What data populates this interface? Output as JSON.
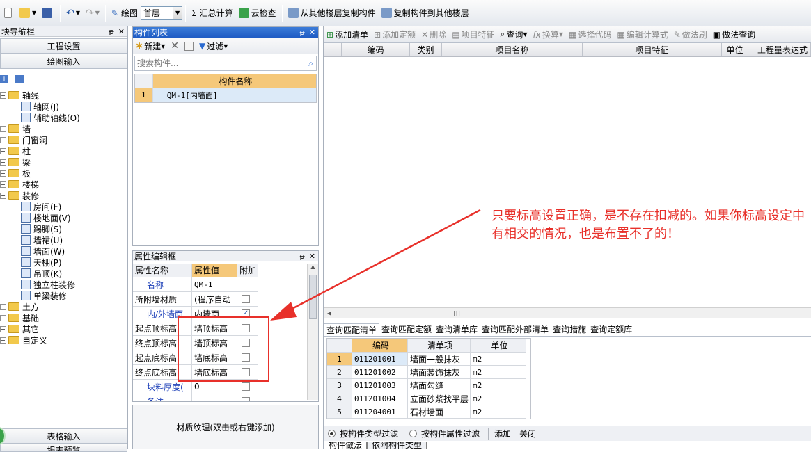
{
  "toolbar": {
    "draw_label": "绘图",
    "floor_value": "首层",
    "sum_label": "汇总计算",
    "cloud_check_label": "云检查",
    "copy_from_label": "从其他楼层复制构件",
    "copy_to_label": "复制构件到其他楼层"
  },
  "nav": {
    "title": "块导航栏",
    "btn_project": "工程设置",
    "btn_draw_input": "绘图输入",
    "btn_table_input": "表格输入",
    "btn_report": "报表预览",
    "tree": [
      {
        "label": "轴线",
        "level": 0,
        "expanded": true
      },
      {
        "label": "轴网(J)",
        "level": 1
      },
      {
        "label": "辅助轴线(O)",
        "level": 1
      },
      {
        "label": "墙",
        "level": 0
      },
      {
        "label": "门窗洞",
        "level": 0
      },
      {
        "label": "柱",
        "level": 0
      },
      {
        "label": "梁",
        "level": 0
      },
      {
        "label": "板",
        "level": 0
      },
      {
        "label": "楼梯",
        "level": 0
      },
      {
        "label": "装修",
        "level": 0,
        "expanded": true
      },
      {
        "label": "房间(F)",
        "level": 1
      },
      {
        "label": "楼地面(V)",
        "level": 1
      },
      {
        "label": "踢脚(S)",
        "level": 1
      },
      {
        "label": "墙裙(U)",
        "level": 1
      },
      {
        "label": "墙面(W)",
        "level": 1
      },
      {
        "label": "天棚(P)",
        "level": 1
      },
      {
        "label": "吊顶(K)",
        "level": 1
      },
      {
        "label": "独立柱装修",
        "level": 1
      },
      {
        "label": "单梁装修",
        "level": 1
      },
      {
        "label": "土方",
        "level": 0
      },
      {
        "label": "基础",
        "level": 0
      },
      {
        "label": "其它",
        "level": 0
      },
      {
        "label": "自定义",
        "level": 0
      }
    ]
  },
  "component_list": {
    "title": "构件列表",
    "new_label": "新建",
    "filter_label": "过滤",
    "search_placeholder": "搜索构件...",
    "col_name": "构件名称",
    "rows": [
      {
        "no": "1",
        "name": "QM-1[内墙面]"
      }
    ]
  },
  "property_editor": {
    "title": "属性编辑框",
    "col_name": "属性名称",
    "col_value": "属性值",
    "col_extra": "附加",
    "rows": [
      {
        "name": "名称",
        "value": "QM-1",
        "blue": true,
        "check": ""
      },
      {
        "name": "所附墙材质",
        "value": "(程序自动",
        "blue": false,
        "check": "box"
      },
      {
        "name": "内/外墙面",
        "value": "内墙面",
        "blue": true,
        "check": "checked"
      },
      {
        "name": "起点顶标高",
        "value": "墙顶标高",
        "blue": false,
        "check": "box"
      },
      {
        "name": "终点顶标高",
        "value": "墙顶标高",
        "blue": false,
        "check": "box"
      },
      {
        "name": "起点底标高",
        "value": "墙底标高",
        "blue": false,
        "check": "box"
      },
      {
        "name": "终点底标高",
        "value": "墙底标高",
        "blue": false,
        "check": "box"
      },
      {
        "name": "块料厚度(",
        "value": "0",
        "blue": true,
        "check": "box"
      },
      {
        "name": "备注",
        "value": "",
        "blue": true,
        "check": "box"
      }
    ],
    "material_hint": "材质纹理(双击或右键添加)"
  },
  "right_toolbar": {
    "add_list": "添加清单",
    "add_quota": "添加定额",
    "delete": "删除",
    "item_feature": "项目特征",
    "query": "查询",
    "convert": "换算",
    "select_code": "选择代码",
    "edit_formula": "编辑计算式",
    "method_brush": "做法刷",
    "method_query": "做法查询"
  },
  "main_grid": {
    "cols": [
      "编码",
      "类别",
      "项目名称",
      "项目特征",
      "单位",
      "工程量表达式"
    ]
  },
  "query_tabs": [
    "查询匹配清单",
    "查询匹配定额",
    "查询清单库",
    "查询匹配外部清单",
    "查询措施",
    "查询定额库"
  ],
  "match_grid": {
    "cols": [
      "编码",
      "清单项",
      "单位"
    ],
    "rows": [
      {
        "no": "1",
        "code": "011201001",
        "item": "墙面一般抹灰",
        "unit": "m2"
      },
      {
        "no": "2",
        "code": "011201002",
        "item": "墙面装饰抹灰",
        "unit": "m2"
      },
      {
        "no": "3",
        "code": "011201003",
        "item": "墙面勾缝",
        "unit": "m2"
      },
      {
        "no": "4",
        "code": "011201004",
        "item": "立面砂浆找平层",
        "unit": "m2"
      },
      {
        "no": "5",
        "code": "011204001",
        "item": "石材墙面",
        "unit": "m2"
      }
    ]
  },
  "filter_bar": {
    "by_type": "按构件类型过滤",
    "by_attr": "按构件属性过滤",
    "add": "添加",
    "close": "关闭"
  },
  "bottom_tabs": [
    "构件做法",
    "依附构件类型"
  ],
  "annotation": {
    "text": "只要标高设置正确，是不存在扣减的。如果你标高设定中有相交的情况，也是布置不了的！",
    "color": "#e8302a"
  },
  "colors": {
    "title_blue": "#2563c9",
    "header_orange": "#f5c87a",
    "annotation_red": "#e8302a"
  }
}
